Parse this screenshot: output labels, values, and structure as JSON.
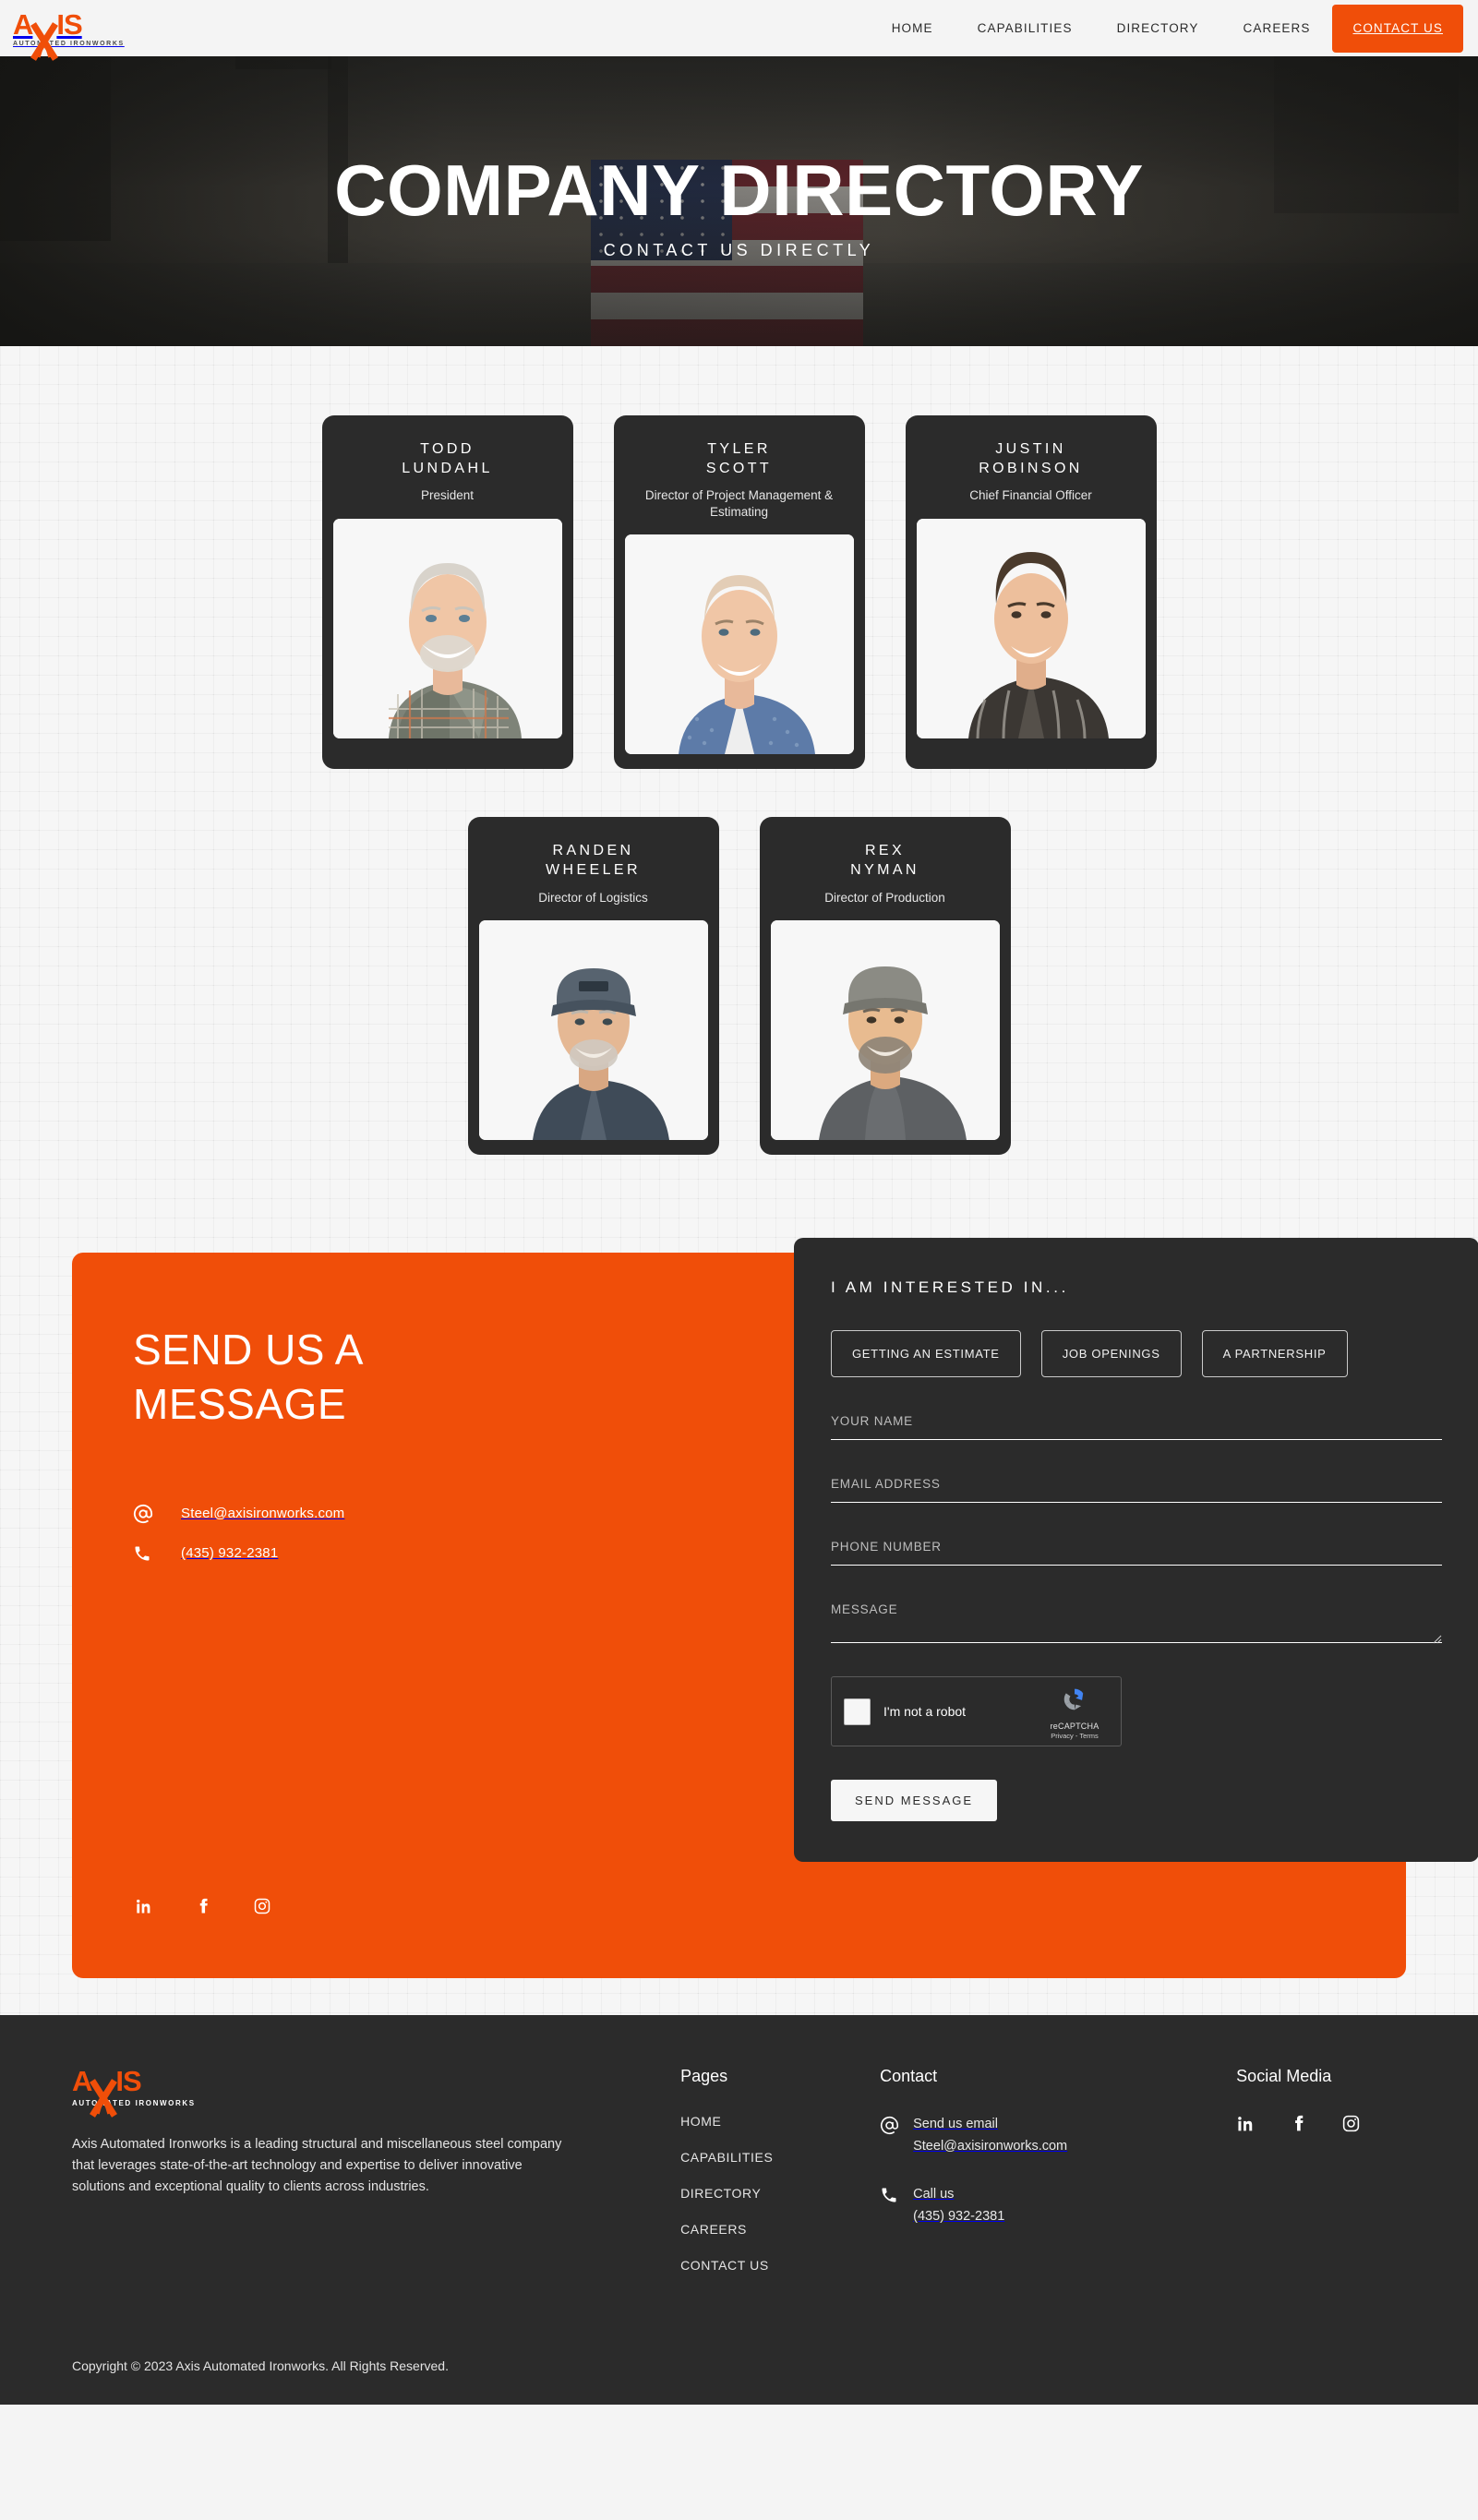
{
  "brand": {
    "name": "AXIS",
    "tagline": "AUTOMATED IRONWORKS",
    "accent": "#f04e09",
    "dark": "#2b2b2b"
  },
  "nav": {
    "links": [
      {
        "label": "HOME"
      },
      {
        "label": "CAPABILITIES"
      },
      {
        "label": "DIRECTORY"
      },
      {
        "label": "CAREERS"
      }
    ],
    "cta": "CONTACT US"
  },
  "hero": {
    "title": "COMPANY DIRECTORY",
    "subtitle": "CONTACT US DIRECTLY"
  },
  "directory": {
    "row1": [
      {
        "first": "TODD",
        "last": "LUNDAHL",
        "role": "President"
      },
      {
        "first": "TYLER",
        "last": "SCOTT",
        "role": "Director of Project Management & Estimating"
      },
      {
        "first": "JUSTIN",
        "last": "ROBINSON",
        "role": "Chief Financial Officer"
      }
    ],
    "row2": [
      {
        "first": "RANDEN",
        "last": "WHEELER",
        "role": "Director of Logistics"
      },
      {
        "first": "REX",
        "last": "NYMAN",
        "role": "Director of Production"
      }
    ]
  },
  "contact": {
    "title": "SEND US A MESSAGE",
    "email": "Steel@axisironworks.com",
    "phone": "(435) 932-2381",
    "socials": [
      {
        "name": "linkedin-icon"
      },
      {
        "name": "facebook-icon"
      },
      {
        "name": "instagram-icon"
      }
    ]
  },
  "form": {
    "heading": "I AM INTERESTED IN...",
    "interests": [
      {
        "label": "GETTING AN ESTIMATE"
      },
      {
        "label": "JOB OPENINGS"
      },
      {
        "label": "A PARTNERSHIP"
      }
    ],
    "fields": [
      {
        "label": "YOUR NAME",
        "value": ""
      },
      {
        "label": "EMAIL ADDRESS",
        "value": ""
      },
      {
        "label": "PHONE NUMBER",
        "value": ""
      },
      {
        "label": "MESSAGE",
        "value": ""
      }
    ],
    "captcha": {
      "label": "I'm not a robot",
      "brand": "reCAPTCHA",
      "terms": "Privacy - Terms"
    },
    "submit": "SEND MESSAGE"
  },
  "footer": {
    "description": "Axis Automated Ironworks is a leading structural and miscellaneous steel company that leverages state-of-the-art technology and expertise to deliver innovative solutions and exceptional quality to clients across industries.",
    "pages": {
      "title": "Pages",
      "links": [
        {
          "label": "HOME"
        },
        {
          "label": "CAPABILITIES"
        },
        {
          "label": "DIRECTORY"
        },
        {
          "label": "CAREERS"
        },
        {
          "label": "CONTACT US"
        }
      ]
    },
    "contact": {
      "title": "Contact",
      "email_label": "Send us email",
      "email_value": "Steel@axisironworks.com",
      "phone_label": "Call us",
      "phone_value": "(435) 932-2381"
    },
    "social": {
      "title": "Social Media",
      "items": [
        {
          "name": "linkedin-icon"
        },
        {
          "name": "facebook-icon"
        },
        {
          "name": "instagram-icon"
        }
      ]
    },
    "copyright": "Copyright © 2023 Axis Automated Ironworks. All Rights Reserved."
  }
}
